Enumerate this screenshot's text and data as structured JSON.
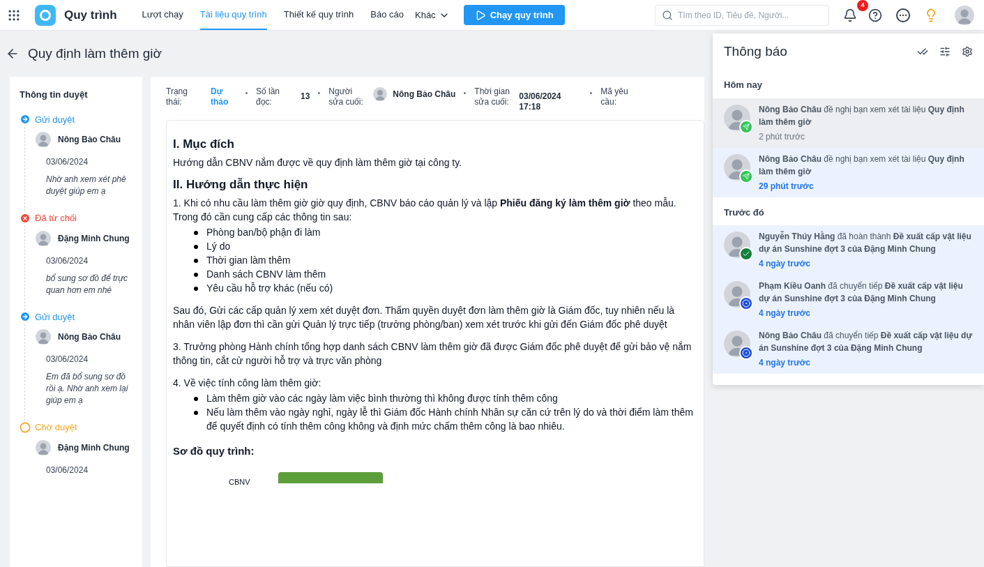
{
  "app": {
    "name": "Quy trình"
  },
  "nav": [
    {
      "label": "Lượt chạy",
      "selected": false
    },
    {
      "label": "Tài liệu quy trình",
      "selected": true
    },
    {
      "label": "Thiết kế quy trình",
      "selected": false
    },
    {
      "label": "Báo cáo",
      "selected": false
    }
  ],
  "nav_more": "Khác",
  "run_button": "Chạy quy trình",
  "search": {
    "placeholder": "Tìm theo ID, Tiêu đề, Người..."
  },
  "notification_count": "4",
  "page_title": "Quy định làm thêm giờ",
  "approval": {
    "title": "Thông tin duyệt",
    "steps": [
      {
        "kind": "sent",
        "status": "Gửi duyệt",
        "person": "Nông Bảo Châu",
        "date": "03/06/2024",
        "note": "Nhờ anh xem xét phê duyệt giúp em ạ"
      },
      {
        "kind": "rejected",
        "status": "Đã từ chối",
        "person": "Đặng Minh Chung",
        "date": "03/06/2024",
        "note": "bổ sung sơ đồ để trực quan hơn em nhé"
      },
      {
        "kind": "sent",
        "status": "Gửi duyệt",
        "person": "Nông Bảo Châu",
        "date": "03/06/2024",
        "note": "Em đã bổ sung sơ đồ rồi ạ. Nhờ anh xem lại giúp em ạ"
      },
      {
        "kind": "pending",
        "status": "Chờ duyệt",
        "person": "Đặng Minh Chung",
        "date": "03/06/2024"
      }
    ]
  },
  "meta": [
    {
      "kind": "status",
      "label": "Trạng thái:",
      "value": "Dự thảo"
    },
    {
      "kind": "text",
      "label": "Số lần đọc:",
      "value": "13"
    },
    {
      "kind": "person",
      "label": "Người sửa cuối:",
      "value": "Nông Bảo Châu"
    },
    {
      "kind": "text",
      "label": "Thời gian sửa cuối:",
      "value": "03/06/2024 17:18"
    },
    {
      "kind": "text",
      "label": "Mã yêu cầu:"
    }
  ],
  "document": [
    {
      "kind": "heading",
      "text": "I. Mục đích"
    },
    {
      "kind": "paragraph",
      "text": "Hướng dẫn CBNV nắm được về quy định làm thêm giờ tại công ty."
    },
    {
      "kind": "heading",
      "text": "II. Hướng dẫn thực hiện"
    },
    {
      "kind": "paragraph",
      "text": "1. Khi có nhu cầu làm thêm giờ giờ quy định, CBNV báo cáo quản lý và lập **Phiếu đăng ký làm thêm giờ** theo mẫu. Trong đó cần cung cấp các thông tin sau:"
    },
    {
      "kind": "bullets",
      "items": [
        "Phòng ban/bộ phận đi làm",
        "Lý do",
        "Thời gian làm thêm",
        "Danh sách CBNV làm thêm",
        "Yêu cầu hỗ trợ khác (nếu có)"
      ]
    },
    {
      "kind": "paragraph",
      "text": "Sau đó, Gửi các cấp quản lý xem xét duyệt đơn. Thẩm quyền duyệt đơn làm thêm giờ là Giám đốc, tuy nhiên nếu là nhân viên lập đơn thì cần gửi Quản lý trực tiếp (trưởng phòng/ban) xem xét trước khi gửi đến Giám đốc phê duyệt"
    },
    {
      "kind": "paragraph",
      "text": "3. Trưởng phòng Hành chính tổng hợp danh sách CBNV làm thêm giờ đã được Giám đốc phê duyệt để gửi bảo vệ nắm thông tin, cắt cử người hỗ trợ và trực văn phòng"
    },
    {
      "kind": "paragraph",
      "text": "4. Về việc tính công làm thêm giờ:"
    },
    {
      "kind": "bullets",
      "items": [
        "Làm thêm giờ vào các ngày làm việc bình thường thì không được tính thêm công",
        "Nếu làm thêm vào ngày nghỉ, ngày lễ thì Giám đốc Hành chính Nhân sự căn cứ trên lý do và thời điểm làm thêm để quyết định có tính thêm công không và định mức chấm thêm công là bao nhiêu."
      ]
    },
    {
      "kind": "subheading",
      "text": "Sơ đồ quy trình:"
    },
    {
      "kind": "diagram",
      "text": "CBNV"
    }
  ],
  "notifications": {
    "title": "Thông báo",
    "groups": [
      {
        "label": "Hôm nay",
        "items": [
          {
            "kind": "send",
            "unread": false,
            "text": "**Nông Bảo Châu** đề nghị bạn xem xét tài liệu **Quy định làm thêm giờ**",
            "time": "2 phút trước"
          },
          {
            "kind": "send",
            "unread": true,
            "text": "**Nông Bảo Châu** đề nghị bạn xem xét tài liệu **Quy định làm thêm giờ**",
            "time": "29 phút trước"
          }
        ]
      },
      {
        "label": "Trước đó",
        "items": [
          {
            "kind": "done",
            "unread": true,
            "text": "**Nguyễn Thúy Hằng** đã hoàn thành **Đề xuất cấp vật liệu dự án Sunshine đợt 3 của Đặng Minh Chung**",
            "time": "4 ngày trước"
          },
          {
            "kind": "forward",
            "unread": true,
            "text": "**Phạm Kiều Oanh** đã chuyển tiếp **Đề xuất cấp vật liệu dự án Sunshine đợt 3 của Đặng Minh Chung**",
            "time": "4 ngày trước"
          },
          {
            "kind": "forward",
            "unread": true,
            "text": "**Nông Bảo Châu** đã chuyển tiếp **Đề xuất cấp vật liệu dự án Sunshine đợt 3 của Đặng Minh Chung**",
            "time": "4 ngày trước"
          }
        ]
      }
    ]
  }
}
